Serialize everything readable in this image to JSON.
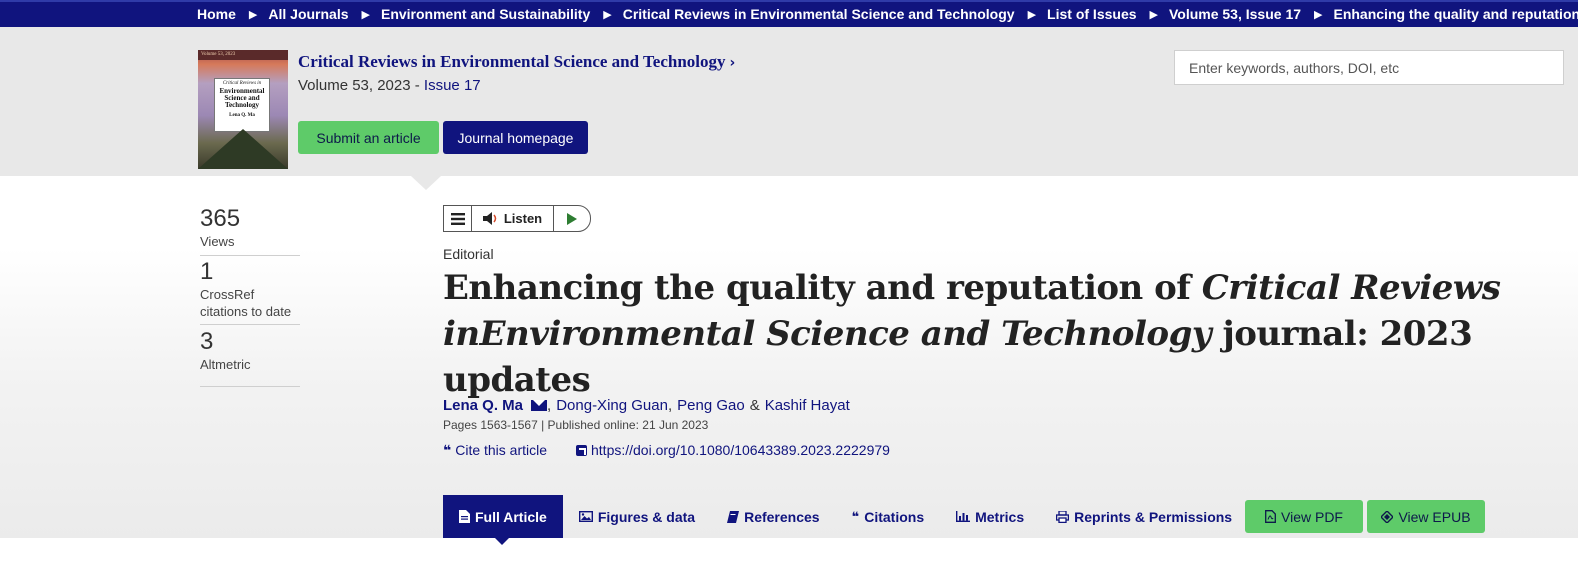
{
  "breadcrumb": {
    "items": [
      "Home",
      "All Journals",
      "Environment and Sustainability",
      "Critical Reviews in Environmental Science and Technology",
      "List of Issues",
      "Volume 53, Issue 17",
      "Enhancing the quality and reputation of ...."
    ],
    "separator": "▶"
  },
  "journal": {
    "title": "Critical Reviews in Environmental Science and Technology",
    "title_chevron": "›",
    "volume_text": "Volume 53, 2023 - ",
    "issue_text": "Issue 17",
    "submit_label": "Submit an article",
    "homepage_label": "Journal homepage",
    "cover": {
      "top_text": "Volume 53, 2023",
      "line1": "Critical Reviews in",
      "line2": "Environmental Science and Technology",
      "line3": "Lena Q. Ma"
    }
  },
  "search": {
    "placeholder": "Enter keywords, authors, DOI, etc"
  },
  "metrics": [
    {
      "value": "365",
      "label": "Views"
    },
    {
      "value": "1",
      "label": "CrossRef citations to date"
    },
    {
      "value": "3",
      "label": "Altmetric"
    }
  ],
  "listen": {
    "label": "Listen"
  },
  "article": {
    "type": "Editorial",
    "title_part1": "Enhancing the quality and reputation of ",
    "title_italic": "Critical Reviews inEnvironmental Science and Technology",
    "title_part2": " journal: 2023 updates",
    "authors": {
      "first": "Lena Q. Ma",
      "second": "Dong-Xing Guan",
      "third": "Peng Gao",
      "fourth": "Kashif Hayat",
      "comma": ",",
      "amp": "&"
    },
    "pub_info": "Pages 1563-1567 | Published online: 21 Jun 2023",
    "cite_label": "Cite this article",
    "doi": "https://doi.org/10.1080/10643389.2023.2222979"
  },
  "tabs": [
    {
      "label": "Full Article",
      "icon": "document-icon"
    },
    {
      "label": "Figures & data",
      "icon": "image-icon"
    },
    {
      "label": "References",
      "icon": "book-icon"
    },
    {
      "label": "Citations",
      "icon": "quote-icon"
    },
    {
      "label": "Metrics",
      "icon": "bar-chart-icon"
    },
    {
      "label": "Reprints & Permissions",
      "icon": "printer-icon"
    }
  ],
  "actions": {
    "pdf_label": "View PDF",
    "epub_label": "View EPUB"
  },
  "colors": {
    "navy": "#10147e",
    "green": "#5ecb69",
    "header_bg": "#e8e8e8"
  }
}
